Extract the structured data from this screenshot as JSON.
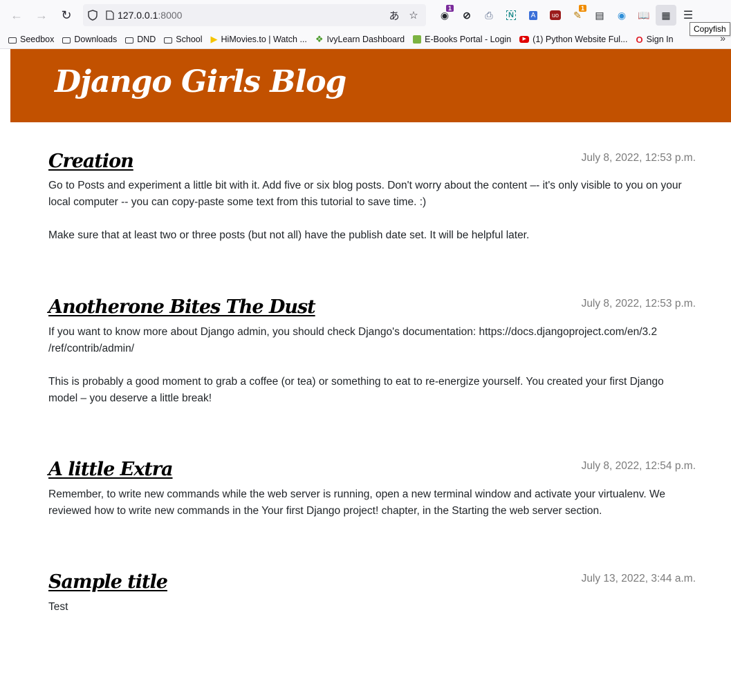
{
  "browser": {
    "url_host": "127.0.0.1",
    "url_port": ":8000",
    "tooltip": "Copyfish",
    "extensions": [
      {
        "icon": "cookie-icon",
        "badge": "1",
        "badge_color": "#7a2b9b"
      },
      {
        "icon": "block-icon"
      },
      {
        "icon": "printer-icon"
      },
      {
        "icon": "n-icon"
      },
      {
        "icon": "translate-icon"
      },
      {
        "icon": "ublock-icon"
      },
      {
        "icon": "pen-icon",
        "badge": "1",
        "badge_color": "#f08c00"
      },
      {
        "icon": "reader-icon"
      },
      {
        "icon": "vpn-icon"
      },
      {
        "icon": "book-icon"
      },
      {
        "icon": "copyfish-icon"
      },
      {
        "icon": "menu-icon"
      }
    ],
    "bookmarks": [
      {
        "label": "Seedbox",
        "icon": "folder-icon"
      },
      {
        "label": "Downloads",
        "icon": "folder-icon"
      },
      {
        "label": "DND",
        "icon": "folder-icon"
      },
      {
        "label": "School",
        "icon": "folder-icon"
      },
      {
        "label": "HiMovies.to | Watch ...",
        "icon": "play-icon"
      },
      {
        "label": "IvyLearn Dashboard",
        "icon": "ivy-icon"
      },
      {
        "label": "E-Books Portal - Login",
        "icon": "android-icon"
      },
      {
        "label": "(1) Python Website Ful...",
        "icon": "youtube-icon"
      },
      {
        "label": "Sign In",
        "icon": "opera-icon"
      }
    ]
  },
  "site": {
    "title": "Django Girls Blog",
    "header_color": "#c25100"
  },
  "posts": [
    {
      "title": "Creation",
      "date": "July 8, 2022, 12:53 p.m.",
      "paragraphs": [
        "Go to Posts and experiment a little bit with it. Add five or six blog posts. Don't worry about the content –- it's only visible to you on your local computer -- you can copy-paste some text from this tutorial to save time. :)",
        "Make sure that at least two or three posts (but not all) have the publish date set. It will be helpful later."
      ]
    },
    {
      "title": "Anotherone Bites The Dust",
      "date": "July 8, 2022, 12:53 p.m.",
      "paragraphs": [
        "If you want to know more about Django admin, you should check Django's documentation: https://docs.djangoproject.com/en/3.2 /ref/contrib/admin/",
        "This is probably a good moment to grab a coffee (or tea) or something to eat to re-energize yourself. You created your first Django model – you deserve a little break!"
      ]
    },
    {
      "title": "A little Extra",
      "date": "July 8, 2022, 12:54 p.m.",
      "paragraphs": [
        "Remember, to write new commands while the web server is running, open a new terminal window and activate your virtualenv. We reviewed how to write new commands in the Your first Django project! chapter, in the Starting the web server section."
      ]
    },
    {
      "title": "Sample title",
      "date": "July 13, 2022, 3:44 a.m.",
      "paragraphs": [
        "Test"
      ]
    }
  ]
}
